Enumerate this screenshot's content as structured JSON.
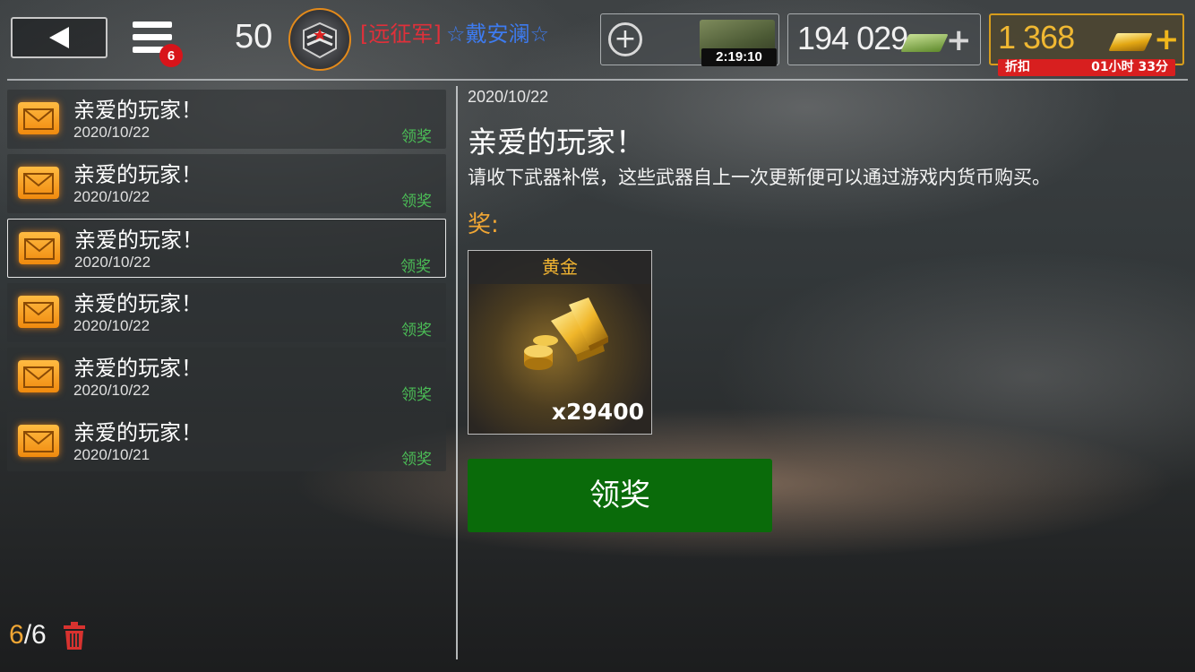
{
  "topbar": {
    "menu_badge": "6",
    "level": "50",
    "player_tag": "[远征军]",
    "player_name": "☆戴安澜☆",
    "tank_timer": "2:19:10",
    "cash_value": "194 029",
    "gold_value": "1 368",
    "discount_label": "折扣",
    "discount_time": "01小时 33分"
  },
  "mail": {
    "items": [
      {
        "title": "亲爱的玩家！",
        "date": "2020/10/22",
        "action": "领奖",
        "selected": false
      },
      {
        "title": "亲爱的玩家！",
        "date": "2020/10/22",
        "action": "领奖",
        "selected": false
      },
      {
        "title": "亲爱的玩家！",
        "date": "2020/10/22",
        "action": "领奖",
        "selected": true
      },
      {
        "title": "亲爱的玩家！",
        "date": "2020/10/22",
        "action": "领奖",
        "selected": false
      },
      {
        "title": "亲爱的玩家！",
        "date": "2020/10/22",
        "action": "领奖",
        "selected": false
      },
      {
        "title": "亲爱的玩家！",
        "date": "2020/10/21",
        "action": "领奖",
        "selected": false
      }
    ],
    "counter_current": "6",
    "counter_sep": "/",
    "counter_total": "6"
  },
  "detail": {
    "date": "2020/10/22",
    "title": "亲爱的玩家！",
    "body": "请收下武器补偿，这些武器自上一次更新便可以通过游戏内货币购买。",
    "reward_label": "奖:",
    "reward": {
      "name": "黄金",
      "quantity": "x29400"
    },
    "claim_button": "领奖"
  },
  "colors": {
    "accent_orange": "#f0a634",
    "claim_green": "#0a6b0a",
    "claim_text_green": "#4bbd56",
    "tag_red": "#e0303a",
    "name_blue": "#3d7bf0",
    "gold": "#f2b531"
  },
  "icons": [
    "back-arrow-icon",
    "menu-icon",
    "rank-insignia-icon",
    "add-icon",
    "tank-icon",
    "cash-icon",
    "gold-bar-icon",
    "envelope-icon",
    "trash-icon",
    "gold-pile-icon"
  ]
}
